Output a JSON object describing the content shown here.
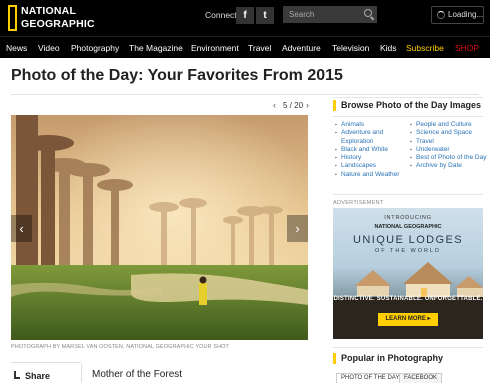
{
  "header": {
    "logo": "NATIONAL GEOGRAPHIC",
    "logo_line1": "NATIONAL",
    "logo_line2": "GEOGRAPHIC",
    "connect_label": "Connect",
    "facebook_glyph": "f",
    "twitter_glyph": "t",
    "search_placeholder": "Search",
    "loading_label": "Loading..."
  },
  "nav": {
    "items": [
      "News",
      "Video",
      "Photography",
      "The Magazine",
      "Environment",
      "Travel",
      "Adventure",
      "Television",
      "Kids",
      "Subscribe",
      "SHOP"
    ]
  },
  "page": {
    "title": "Photo of the Day: Your Favorites From 2015"
  },
  "pager": {
    "prev_glyph": "‹",
    "next_glyph": "›",
    "count": "5 / 20"
  },
  "photo": {
    "credit": "PHOTOGRAPH BY MARSEL VAN OOSTEN, NATIONAL GEOGRAPHIC YOUR SHOT",
    "title": "Mother of the Forest",
    "prev_arrow": "‹",
    "next_arrow": "›"
  },
  "share": {
    "label": "Share"
  },
  "sidebar": {
    "browse_heading": "Browse Photo of the Day Images",
    "categories_left": [
      "Animals",
      "Adventure and",
      "Exploration",
      "Black and White",
      "History",
      "Landscapes",
      "Nature and Weather"
    ],
    "categories_right": [
      "People and Culture",
      "Science and Space",
      "Travel",
      "Underwater",
      "Best of Photo of the Day",
      "Archive by Date"
    ],
    "ad_label": "ADVERTISEMENT",
    "ad": {
      "introducing": "INTRODUCING",
      "brand": "NATIONAL GEOGRAPHIC",
      "headline": "UNIQUE LODGES",
      "sub": "OF THE WORLD",
      "tagline": "DISTINCTIVE. SUSTAINABLE. UNFORGETTABLE.",
      "cta": "LEARN MORE ▸"
    },
    "popular_heading": "Popular in Photography",
    "tabs": [
      "PHOTO OF THE DAY",
      "FACEBOOK"
    ]
  },
  "colors": {
    "accent": "#ffce00",
    "link": "#2a73b7",
    "shop": "#dd1111"
  }
}
